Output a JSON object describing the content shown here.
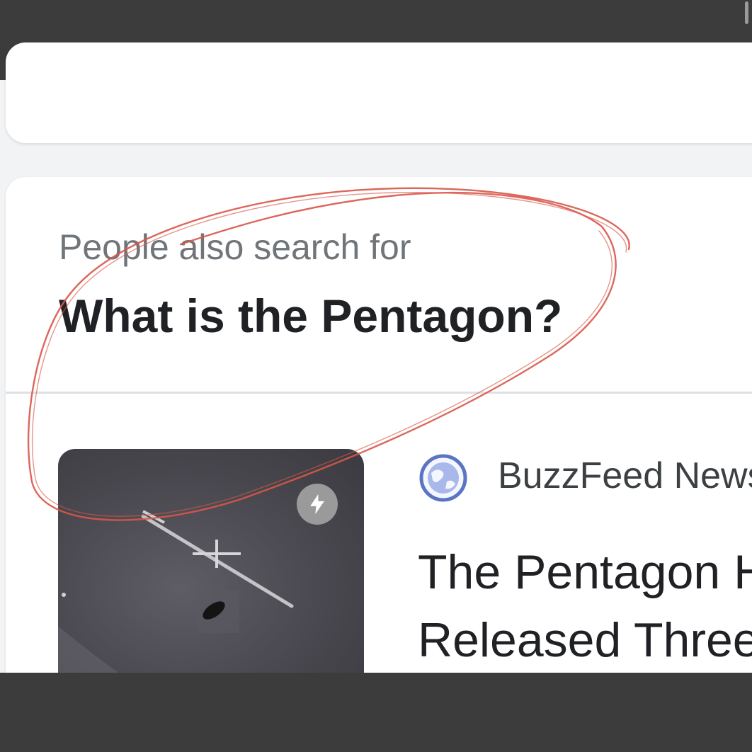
{
  "people_also_search": {
    "label": "People also search for",
    "title": "What is the Pentagon?"
  },
  "result": {
    "source": "BuzzFeed News",
    "source_icon": "globe-icon",
    "headline_lines": [
      "The Pentagon Has",
      "Released Three"
    ],
    "badge_icon": "lightning-bolt-icon"
  },
  "colors": {
    "annotation": "#d9574a",
    "background": "#f1f3f4",
    "frame": "#3c3c3c"
  }
}
